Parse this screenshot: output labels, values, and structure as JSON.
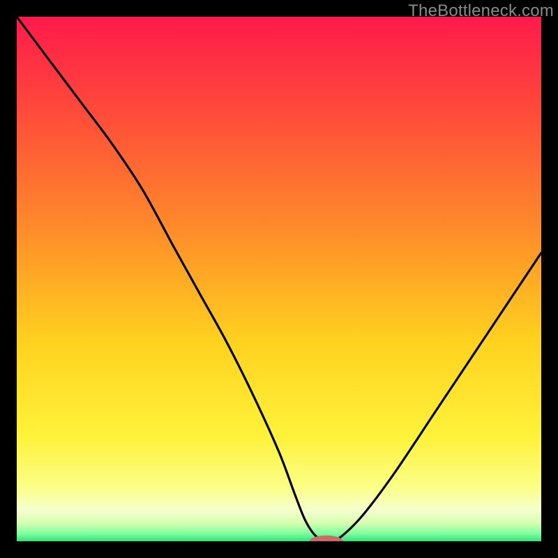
{
  "watermark": "TheBottleneck.com",
  "colors": {
    "frame": "#000000",
    "curve": "#000000",
    "marker_fill": "#cf6a66",
    "gradient_stops": [
      {
        "offset": 0.0,
        "color": "#ff1a4b"
      },
      {
        "offset": 0.18,
        "color": "#ff4a3a"
      },
      {
        "offset": 0.4,
        "color": "#ff8a2a"
      },
      {
        "offset": 0.62,
        "color": "#ffd21f"
      },
      {
        "offset": 0.8,
        "color": "#fff23a"
      },
      {
        "offset": 0.9,
        "color": "#fbff8a"
      },
      {
        "offset": 0.94,
        "color": "#f6ffcf"
      },
      {
        "offset": 0.965,
        "color": "#d6ffb0"
      },
      {
        "offset": 0.985,
        "color": "#7fffa0"
      },
      {
        "offset": 1.0,
        "color": "#31e27b"
      }
    ]
  },
  "chart_data": {
    "type": "line",
    "title": "",
    "xlabel": "",
    "ylabel": "",
    "xlim": [
      0,
      100
    ],
    "ylim": [
      0,
      100
    ],
    "x": [
      0,
      6,
      12,
      18,
      24,
      30,
      35,
      40,
      45,
      50,
      53,
      55,
      57,
      59,
      60,
      62,
      66,
      72,
      80,
      90,
      100
    ],
    "values": [
      100,
      92,
      84,
      76,
      67,
      56,
      47,
      38,
      28,
      17,
      9,
      4,
      1,
      0,
      0,
      1,
      5,
      13,
      25,
      40,
      55
    ],
    "marker": {
      "x": 59,
      "y": 0,
      "rx": 3.2,
      "ry": 1.1
    }
  }
}
